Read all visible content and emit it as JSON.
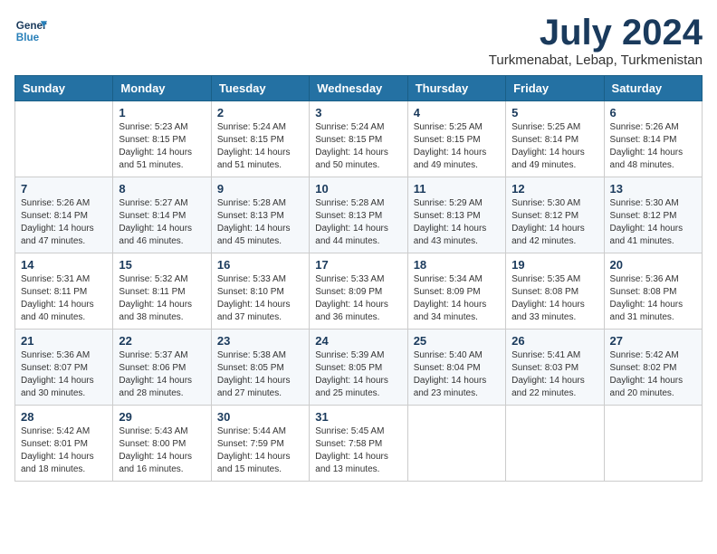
{
  "logo": {
    "line1": "General",
    "line2": "Blue"
  },
  "title": "July 2024",
  "subtitle": "Turkmenabat, Lebap, Turkmenistan",
  "headers": [
    "Sunday",
    "Monday",
    "Tuesday",
    "Wednesday",
    "Thursday",
    "Friday",
    "Saturday"
  ],
  "weeks": [
    [
      {
        "day": "",
        "info": ""
      },
      {
        "day": "1",
        "info": "Sunrise: 5:23 AM\nSunset: 8:15 PM\nDaylight: 14 hours\nand 51 minutes."
      },
      {
        "day": "2",
        "info": "Sunrise: 5:24 AM\nSunset: 8:15 PM\nDaylight: 14 hours\nand 51 minutes."
      },
      {
        "day": "3",
        "info": "Sunrise: 5:24 AM\nSunset: 8:15 PM\nDaylight: 14 hours\nand 50 minutes."
      },
      {
        "day": "4",
        "info": "Sunrise: 5:25 AM\nSunset: 8:15 PM\nDaylight: 14 hours\nand 49 minutes."
      },
      {
        "day": "5",
        "info": "Sunrise: 5:25 AM\nSunset: 8:14 PM\nDaylight: 14 hours\nand 49 minutes."
      },
      {
        "day": "6",
        "info": "Sunrise: 5:26 AM\nSunset: 8:14 PM\nDaylight: 14 hours\nand 48 minutes."
      }
    ],
    [
      {
        "day": "7",
        "info": "Sunrise: 5:26 AM\nSunset: 8:14 PM\nDaylight: 14 hours\nand 47 minutes."
      },
      {
        "day": "8",
        "info": "Sunrise: 5:27 AM\nSunset: 8:14 PM\nDaylight: 14 hours\nand 46 minutes."
      },
      {
        "day": "9",
        "info": "Sunrise: 5:28 AM\nSunset: 8:13 PM\nDaylight: 14 hours\nand 45 minutes."
      },
      {
        "day": "10",
        "info": "Sunrise: 5:28 AM\nSunset: 8:13 PM\nDaylight: 14 hours\nand 44 minutes."
      },
      {
        "day": "11",
        "info": "Sunrise: 5:29 AM\nSunset: 8:13 PM\nDaylight: 14 hours\nand 43 minutes."
      },
      {
        "day": "12",
        "info": "Sunrise: 5:30 AM\nSunset: 8:12 PM\nDaylight: 14 hours\nand 42 minutes."
      },
      {
        "day": "13",
        "info": "Sunrise: 5:30 AM\nSunset: 8:12 PM\nDaylight: 14 hours\nand 41 minutes."
      }
    ],
    [
      {
        "day": "14",
        "info": "Sunrise: 5:31 AM\nSunset: 8:11 PM\nDaylight: 14 hours\nand 40 minutes."
      },
      {
        "day": "15",
        "info": "Sunrise: 5:32 AM\nSunset: 8:11 PM\nDaylight: 14 hours\nand 38 minutes."
      },
      {
        "day": "16",
        "info": "Sunrise: 5:33 AM\nSunset: 8:10 PM\nDaylight: 14 hours\nand 37 minutes."
      },
      {
        "day": "17",
        "info": "Sunrise: 5:33 AM\nSunset: 8:09 PM\nDaylight: 14 hours\nand 36 minutes."
      },
      {
        "day": "18",
        "info": "Sunrise: 5:34 AM\nSunset: 8:09 PM\nDaylight: 14 hours\nand 34 minutes."
      },
      {
        "day": "19",
        "info": "Sunrise: 5:35 AM\nSunset: 8:08 PM\nDaylight: 14 hours\nand 33 minutes."
      },
      {
        "day": "20",
        "info": "Sunrise: 5:36 AM\nSunset: 8:08 PM\nDaylight: 14 hours\nand 31 minutes."
      }
    ],
    [
      {
        "day": "21",
        "info": "Sunrise: 5:36 AM\nSunset: 8:07 PM\nDaylight: 14 hours\nand 30 minutes."
      },
      {
        "day": "22",
        "info": "Sunrise: 5:37 AM\nSunset: 8:06 PM\nDaylight: 14 hours\nand 28 minutes."
      },
      {
        "day": "23",
        "info": "Sunrise: 5:38 AM\nSunset: 8:05 PM\nDaylight: 14 hours\nand 27 minutes."
      },
      {
        "day": "24",
        "info": "Sunrise: 5:39 AM\nSunset: 8:05 PM\nDaylight: 14 hours\nand 25 minutes."
      },
      {
        "day": "25",
        "info": "Sunrise: 5:40 AM\nSunset: 8:04 PM\nDaylight: 14 hours\nand 23 minutes."
      },
      {
        "day": "26",
        "info": "Sunrise: 5:41 AM\nSunset: 8:03 PM\nDaylight: 14 hours\nand 22 minutes."
      },
      {
        "day": "27",
        "info": "Sunrise: 5:42 AM\nSunset: 8:02 PM\nDaylight: 14 hours\nand 20 minutes."
      }
    ],
    [
      {
        "day": "28",
        "info": "Sunrise: 5:42 AM\nSunset: 8:01 PM\nDaylight: 14 hours\nand 18 minutes."
      },
      {
        "day": "29",
        "info": "Sunrise: 5:43 AM\nSunset: 8:00 PM\nDaylight: 14 hours\nand 16 minutes."
      },
      {
        "day": "30",
        "info": "Sunrise: 5:44 AM\nSunset: 7:59 PM\nDaylight: 14 hours\nand 15 minutes."
      },
      {
        "day": "31",
        "info": "Sunrise: 5:45 AM\nSunset: 7:58 PM\nDaylight: 14 hours\nand 13 minutes."
      },
      {
        "day": "",
        "info": ""
      },
      {
        "day": "",
        "info": ""
      },
      {
        "day": "",
        "info": ""
      }
    ]
  ]
}
